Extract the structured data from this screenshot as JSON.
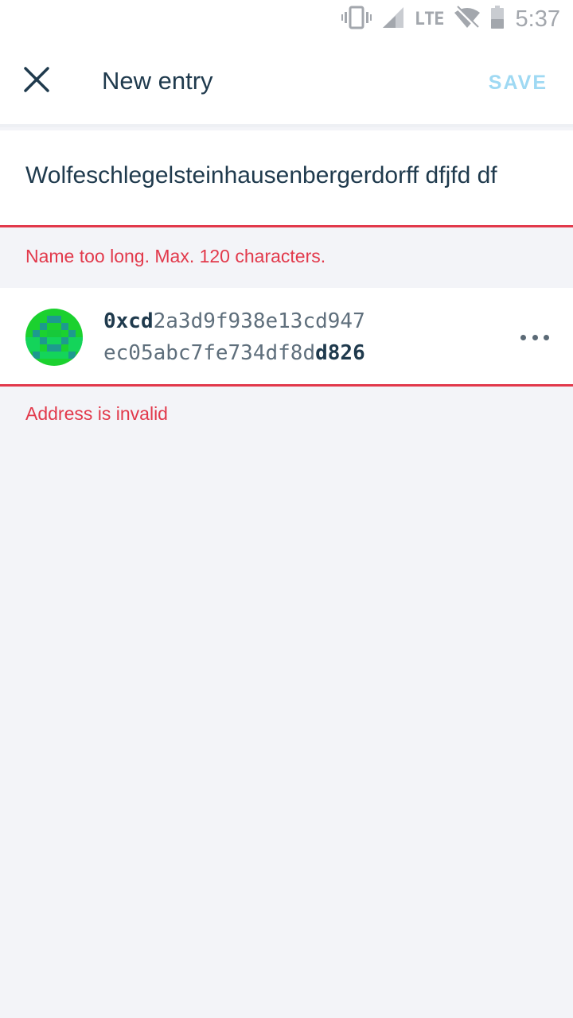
{
  "status_bar": {
    "network": "LTE",
    "time": "5:37",
    "icons": [
      "vibrate-icon",
      "signal-icon",
      "wifi-off-icon",
      "battery-icon"
    ]
  },
  "app_bar": {
    "title": "New entry",
    "save_label": "SAVE",
    "close_icon": "close-icon"
  },
  "name_field": {
    "value": "Wolfeschlegelsteinhausenbergerdorff dfjfd df",
    "error": "Name too long. Max. 120 characters."
  },
  "address": {
    "line1_strong": "0xcd",
    "line1_rest": "2a3d9f938e13cd947",
    "line2_rest": "ec05abc7fe734df8d",
    "line2_strong": "d826",
    "error": "Address is invalid",
    "menu_icon": "more-horizontal-icon"
  },
  "colors": {
    "error": "#e2394b",
    "save_disabled": "#9fd9f3",
    "text_primary": "#1f3a4d",
    "background": "#f3f4f8"
  }
}
